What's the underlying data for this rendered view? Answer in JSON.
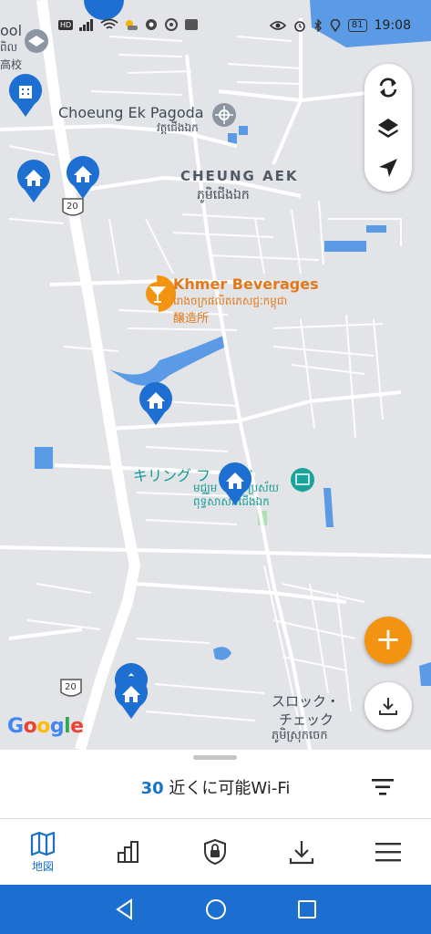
{
  "status_bar": {
    "hd_badge": "HD",
    "battery": "81",
    "time": "19:08"
  },
  "map": {
    "labels": {
      "school_fragment_1": "ool",
      "school_fragment_2": "ពិល",
      "school_fragment_3": "高校",
      "pagoda_name": "Choeung Ek Pagoda",
      "pagoda_khmer": "វត្តជើងឯក",
      "district_name": "CHEUNG AEK",
      "district_khmer": "ភូមិជើងឯក",
      "brewery_name": "Khmer Beverages",
      "brewery_khmer": "រោងចក្រផលិតភេសជ្ជៈកម្ពុជា",
      "brewery_jp": "醸造所",
      "killing_fields_jp": "キリング フ　ルド",
      "killing_fields_khmer_1": "មជ្ឈម",
      "killing_fields_khmer_1b": "ប្រស័យ",
      "killing_fields_khmer_2": "ពុទ្ធសាសនជើងឯក",
      "route_1": "20",
      "route_2": "20",
      "srok_1": "スロック・",
      "srok_2": "チェック",
      "srok_khmer": "ភូមិស្រុកចេក"
    },
    "google_logo": "Google"
  },
  "controls": {
    "refresh_icon": "refresh-icon",
    "layers_icon": "layers-icon",
    "locate_icon": "navigation-arrow-icon",
    "add_icon": "plus-icon",
    "download_icon": "download-icon"
  },
  "sheet": {
    "count": "30",
    "label": "近くに可能Wi-Fi"
  },
  "tabs": [
    {
      "label": "地図",
      "icon": "map-icon",
      "active": true
    },
    {
      "label": "",
      "icon": "bar-chart-icon",
      "active": false
    },
    {
      "label": "",
      "icon": "shield-lock-icon",
      "active": false
    },
    {
      "label": "",
      "icon": "download-icon",
      "active": false
    },
    {
      "label": "",
      "icon": "menu-icon",
      "active": false
    }
  ],
  "colors": {
    "primary": "#1a6fc6",
    "accent": "#f39312",
    "navbar": "#1c6fd0",
    "map_bg": "#e3e4e7",
    "water": "#5b9be6"
  }
}
